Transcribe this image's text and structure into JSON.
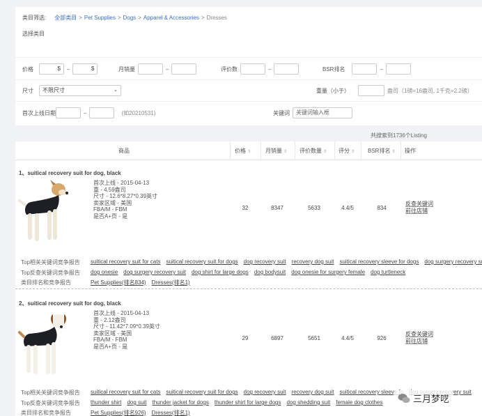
{
  "filters": {
    "category_label": "类目筛选:",
    "breadcrumb": [
      "全部类目",
      "Pet Supplies",
      "Dogs",
      "Apparel & Accessories",
      "Dresses"
    ],
    "select_category_label": "选择类目",
    "price_label": "价格",
    "price_currency": "$",
    "monthly_sales_label": "月销量",
    "reviews_label": "评价数",
    "bsr_label": "BSR排名",
    "size_label": "尺寸",
    "size_value": "不限尺寸",
    "weight_label": "重量（小于）",
    "weight_unit_hint": "盎司（1磅=16盎司, 1千克=2.2磅）",
    "launch_date_label": "首次上线日期",
    "launch_date_hint": "(如20210531)",
    "keyword_label": "关键词",
    "keyword_placeholder": "关键词输入框",
    "dash": "–"
  },
  "result_count": "共搜索到1736个Listing",
  "table": {
    "headers": [
      "商品",
      "价格",
      "月销量",
      "评价数量",
      "评分",
      "BSR排名",
      "操作"
    ],
    "sort_icon": "⇕"
  },
  "products": [
    {
      "title": "1、suitical recovery suit for dog, black",
      "meta": [
        "首次上线 -    2015-04-13",
        "重 -   4.59盎司",
        "尺寸 -   12.6*8.27*0.39英寸",
        "卖家区域 -   美国",
        "FBA/M -    FBM",
        "是否A+页 -   是"
      ],
      "price": "32",
      "sales": "8347",
      "reviews": "5633",
      "rating": "4.4/5",
      "bsr": "834",
      "ops": [
        "反查关键词",
        "前往店铺"
      ],
      "kw_rows": [
        {
          "label": "Top相关关键词竞争报告",
          "items": [
            "suitical recovery suit for cats",
            "suitical recovery suit for dogs",
            "dog recovery suit",
            "recovery dog suit",
            "suitical recovery sleeve for dogs",
            "dog surgery recovery suit"
          ]
        },
        {
          "label": "Top反查关键词竞争报告",
          "items": [
            "dog onesie",
            "dog surgery recovery suit",
            "dog shirt for large dogs",
            "dog bodysuit",
            "dog onesie for surgery female",
            "dog turtleneck"
          ]
        },
        {
          "label": "类目排名和竞争报告",
          "items": [
            "Pet Supplies(排名834)",
            "Dresses(排名1)"
          ]
        }
      ]
    },
    {
      "title": "2、suitical recovery suit for dog, black",
      "meta": [
        "首次上线 -    2015-04-13",
        "重 -   2.12盎司",
        "尺寸 -   11.42*7.09*0.39英寸",
        "卖家区域 -   美国",
        "FBA/M -    FBM",
        "是否A+页 -   是"
      ],
      "price": "29",
      "sales": "6897",
      "reviews": "5651",
      "rating": "4.4/5",
      "bsr": "926",
      "ops": [
        "反查关键词",
        "前往店铺"
      ],
      "kw_rows": [
        {
          "label": "Top相关关键词竞争报告",
          "items": [
            "suitical recovery suit for cats",
            "suitical recovery suit for dogs",
            "dog recovery suit",
            "recovery dog suit",
            "suitical recovery sleeve fo",
            "dog surgery recovery suit"
          ]
        },
        {
          "label": "Top反查关键词竞争报告",
          "items": [
            "thunder shirt",
            "dog suit",
            "thunder jacket for dogs",
            "thunder shirt for large dogs",
            "dog shedding suit",
            "female dog clothes"
          ]
        },
        {
          "label": "类目排名和竞争报告",
          "items": [
            "Pet Supplies(排名926)",
            "Dresses(排名1)"
          ]
        }
      ]
    }
  ],
  "watermark": "三月梦呓"
}
